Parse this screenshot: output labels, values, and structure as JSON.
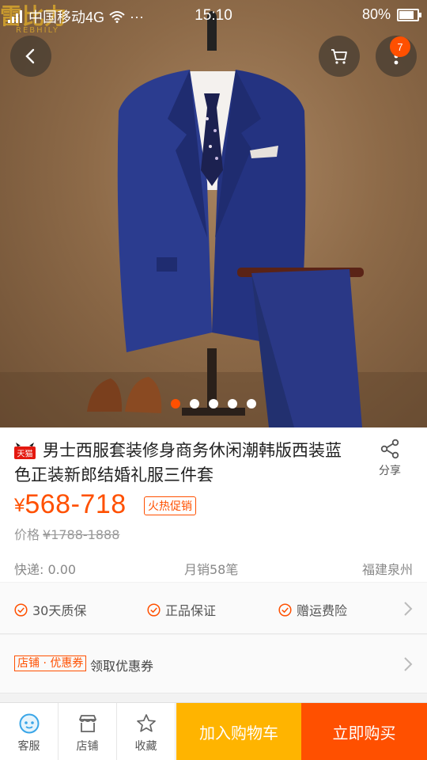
{
  "status_bar": {
    "carrier": "中国移动4G",
    "dots": "···",
    "time": "15:10",
    "battery": "80%",
    "battery_level": 0.8
  },
  "hero": {
    "brand_logo_text": "REBHILY",
    "slide_count": 5,
    "active_slide": 1
  },
  "header": {
    "cart_badge": "7"
  },
  "product": {
    "store_tag": "天猫",
    "title": "男士西服套装修身商务休闲潮韩版西装蓝色正装新郎结婚礼服三件套",
    "share_label": "分享",
    "price_symbol": "¥",
    "price": "568-718",
    "promo_tag": "火热促销",
    "orig_label": "价格",
    "orig_price": "¥1788-1888",
    "shipping": "快递: 0.00",
    "monthly_sales": "月销58笔",
    "location": "福建泉州"
  },
  "guarantees": [
    {
      "label": "30天质保"
    },
    {
      "label": "正品保证"
    },
    {
      "label": "赠运费险"
    }
  ],
  "coupon": {
    "tag": "店铺 · 优惠券",
    "text": "领取优惠券"
  },
  "bottom_bar": {
    "service": "客服",
    "shop": "店铺",
    "favorite": "收藏",
    "add_to_cart": "加入购物车",
    "buy_now": "立即购买"
  },
  "colors": {
    "accent": "#ff5000",
    "cart_button": "#ffb400",
    "icon_blue": "#3aa6e8"
  }
}
